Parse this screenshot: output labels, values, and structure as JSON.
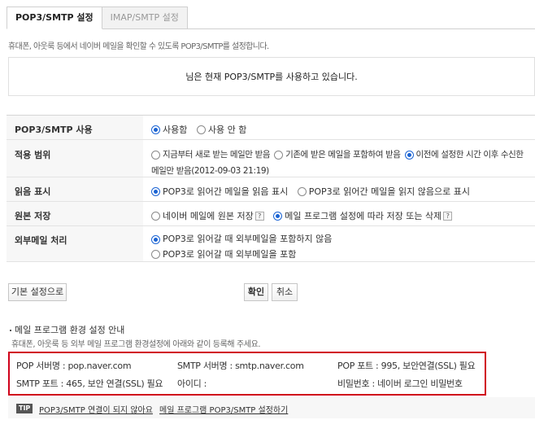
{
  "tabs": [
    {
      "label": "POP3/SMTP 설정",
      "active": true
    },
    {
      "label": "IMAP/SMTP 설정",
      "active": false
    }
  ],
  "description": "휴대폰, 아웃룩 등에서 네이버 메일을 확인할 수 있도록 POP3/SMTP를 설정합니다.",
  "status_message": "님은 현재 POP3/SMTP를 사용하고 있습니다.",
  "settings": {
    "use": {
      "label": "POP3/SMTP 사용",
      "options": [
        "사용함",
        "사용 안 함"
      ],
      "selected": 0
    },
    "scope": {
      "label": "적용 범위",
      "options": [
        "지금부터 새로 받는 메일만 받음",
        "기존에 받은 메일을 포함하여 받음",
        "이전에 설정한 시간 이후 수신한"
      ],
      "continuation": "메일만 받음(2012-09-03 21:19)",
      "selected": 2
    },
    "read_mark": {
      "label": "읽음 표시",
      "options": [
        "POP3로 읽어간 메일을 읽음 표시",
        "POP3로 읽어간 메일을 읽지 않음으로 표시"
      ],
      "selected": 0
    },
    "original": {
      "label": "원본 저장",
      "options": [
        "네이버 메일에 원본 저장",
        "메일 프로그램 설정에 따라 저장 또는 삭제"
      ],
      "help_glyph": "?",
      "selected": 1
    },
    "external": {
      "label": "외부메일 처리",
      "options": [
        "POP3로 읽어갈 때 외부메일을 포함하지 않음",
        "POP3로 읽어갈 때 외부메일을 포함"
      ],
      "selected": 0
    }
  },
  "buttons": {
    "default": "기본 설정으로",
    "confirm": "확인",
    "cancel": "취소"
  },
  "guide": {
    "title": "메일 프로그램 환경 설정 안내",
    "description": "휴대폰, 아웃룩 등 외부 메일 프로그램 환경설정에 아래와 같이 등록해 주세요.",
    "pop_server": "POP 서버명 : pop.naver.com",
    "smtp_server": "SMTP 서버명 : smtp.naver.com",
    "pop_port": "POP 포트 : 995, 보안연결(SSL) 필요",
    "smtp_port": "SMTP 포트 : 465, 보안 연결(SSL) 필요",
    "id": "아이디 :",
    "password": "비밀번호 : 네이버 로그인 비밀번호"
  },
  "tip": {
    "badge": "TIP",
    "link1": "POP3/SMTP 연결이 되지 않아요",
    "link2": "메일 프로그램 POP3/SMTP 설정하기"
  },
  "colors": {
    "accent": "#1a63d3",
    "highlight_border": "#d0021b"
  }
}
